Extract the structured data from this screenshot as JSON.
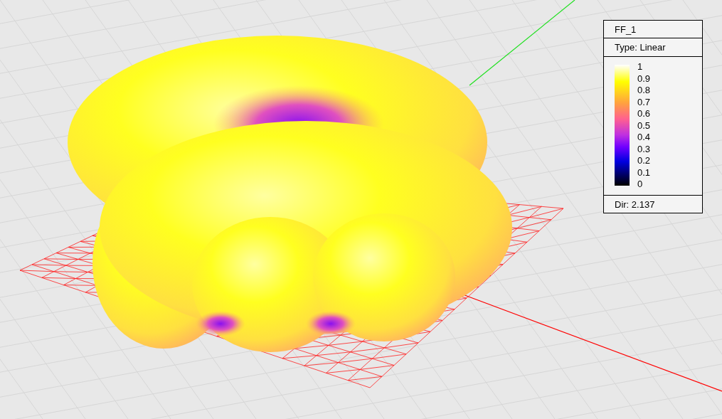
{
  "legend": {
    "title": "FF_1",
    "type": "Type: Linear",
    "ticks": [
      "1",
      "0.9",
      "0.8",
      "0.7",
      "0.6",
      "0.5",
      "0.4",
      "0.3",
      "0.2",
      "0.1",
      "0"
    ],
    "footer": "Dir: 2.137"
  }
}
